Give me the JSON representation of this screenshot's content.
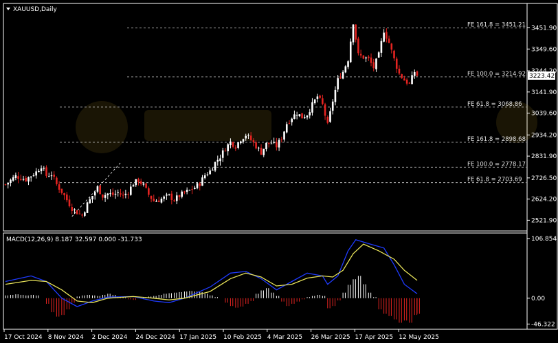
{
  "window": {
    "symbol_title": "XAUUSD,Daily",
    "macd_title": "MACD(12,26,9) 8.187 32.597 0.000 -31.733",
    "current_price": "3223.42"
  },
  "colors": {
    "background": "#000000",
    "axis": "#ffffff",
    "bull_candle": "#ffffff",
    "bear_candle": "#e52421",
    "fib_line": "#c8c8c8",
    "macd_line": "#1f3bff",
    "signal_line": "#e8e35a",
    "hist_pos": "#ffffff",
    "hist_neg": "#e52421"
  },
  "chart_data": [
    {
      "type": "candlestick",
      "title": "XAUUSD,Daily",
      "ylim": [
        2480,
        3560
      ],
      "y_ticks": [
        "3451.90",
        "3349.60",
        "3244.20",
        "3141.90",
        "3039.60",
        "2934.20",
        "2831.90",
        "2726.50",
        "2624.20",
        "2521.90"
      ],
      "x_ticks": [
        "17 Oct 2024",
        "8 Nov 2024",
        "2 Dec 2024",
        "24 Dec 2024",
        "17 Jan 2025",
        "10 Feb 2025",
        "4 Mar 2025",
        "26 Mar 2025",
        "17 Apr 2025",
        "12 May 2025"
      ],
      "fib_levels": [
        {
          "label": "FE 161.8 = 3451.21",
          "value": 3451.21
        },
        {
          "label": "FE 100.0 = 3214.92",
          "value": 3214.92
        },
        {
          "label": "FE 61.8 = 3068.86",
          "value": 3068.86
        },
        {
          "label": "FE 161.8 = 2898.68",
          "value": 2898.68
        },
        {
          "label": "FE 100.0 = 2778.17",
          "value": 2778.17
        },
        {
          "label": "FE 61.8 = 2703.69",
          "value": 2703.69
        }
      ],
      "trendline": {
        "from": [
          2536,
          2540
        ],
        "to": [
          2555,
          2800
        ]
      },
      "close_path": [
        [
          0,
          2695
        ],
        [
          4,
          2735
        ],
        [
          8,
          2720
        ],
        [
          12,
          2755
        ],
        [
          14,
          2785
        ],
        [
          16,
          2738
        ],
        [
          18,
          2745
        ],
        [
          20,
          2695
        ],
        [
          22,
          2660
        ],
        [
          24,
          2620
        ],
        [
          26,
          2580
        ],
        [
          28,
          2560
        ],
        [
          30,
          2545
        ],
        [
          32,
          2600
        ],
        [
          34,
          2640
        ],
        [
          36,
          2680
        ],
        [
          38,
          2640
        ],
        [
          40,
          2650
        ],
        [
          42,
          2645
        ],
        [
          44,
          2655
        ],
        [
          46,
          2640
        ],
        [
          48,
          2660
        ],
        [
          50,
          2700
        ],
        [
          52,
          2715
        ],
        [
          54,
          2690
        ],
        [
          56,
          2645
        ],
        [
          58,
          2615
        ],
        [
          60,
          2620
        ],
        [
          62,
          2630
        ],
        [
          64,
          2640
        ],
        [
          66,
          2620
        ],
        [
          68,
          2640
        ],
        [
          70,
          2655
        ],
        [
          72,
          2665
        ],
        [
          74,
          2680
        ],
        [
          76,
          2700
        ],
        [
          78,
          2740
        ],
        [
          80,
          2760
        ],
        [
          82,
          2800
        ],
        [
          84,
          2830
        ],
        [
          86,
          2870
        ],
        [
          88,
          2900
        ],
        [
          90,
          2880
        ],
        [
          92,
          2915
        ],
        [
          94,
          2935
        ],
        [
          96,
          2910
        ],
        [
          98,
          2880
        ],
        [
          100,
          2850
        ],
        [
          102,
          2890
        ],
        [
          104,
          2895
        ],
        [
          106,
          2880
        ],
        [
          108,
          2920
        ],
        [
          110,
          2990
        ],
        [
          112,
          3020
        ],
        [
          114,
          3040
        ],
        [
          116,
          3020
        ],
        [
          118,
          3035
        ],
        [
          120,
          3080
        ],
        [
          122,
          3120
        ],
        [
          124,
          3080
        ],
        [
          126,
          2980
        ],
        [
          128,
          3100
        ],
        [
          130,
          3200
        ],
        [
          132,
          3240
        ],
        [
          134,
          3300
        ],
        [
          136,
          3480
        ],
        [
          138,
          3320
        ],
        [
          140,
          3310
        ],
        [
          142,
          3300
        ],
        [
          144,
          3260
        ],
        [
          146,
          3320
        ],
        [
          148,
          3440
        ],
        [
          150,
          3380
        ],
        [
          152,
          3300
        ],
        [
          154,
          3230
        ],
        [
          156,
          3200
        ],
        [
          158,
          3180
        ],
        [
          160,
          3240
        ],
        [
          161,
          3223
        ]
      ]
    },
    {
      "type": "macd",
      "title": "MACD(12,26,9) 8.187 32.597 0.000 -31.733",
      "ylim": [
        -52,
        112
      ],
      "y_ticks": [
        "106.854",
        "0.00",
        "-46.322"
      ],
      "macd_line": [
        [
          0,
          30
        ],
        [
          10,
          40
        ],
        [
          16,
          30
        ],
        [
          22,
          0
        ],
        [
          28,
          -15
        ],
        [
          34,
          -5
        ],
        [
          40,
          2
        ],
        [
          50,
          3
        ],
        [
          58,
          -5
        ],
        [
          64,
          -8
        ],
        [
          70,
          0
        ],
        [
          80,
          20
        ],
        [
          88,
          45
        ],
        [
          94,
          48
        ],
        [
          100,
          35
        ],
        [
          106,
          15
        ],
        [
          112,
          30
        ],
        [
          118,
          45
        ],
        [
          124,
          40
        ],
        [
          126,
          25
        ],
        [
          130,
          40
        ],
        [
          134,
          85
        ],
        [
          137,
          105
        ],
        [
          142,
          98
        ],
        [
          148,
          90
        ],
        [
          152,
          60
        ],
        [
          156,
          25
        ],
        [
          161,
          8
        ]
      ],
      "signal_line": [
        [
          0,
          25
        ],
        [
          10,
          32
        ],
        [
          16,
          30
        ],
        [
          22,
          15
        ],
        [
          28,
          -5
        ],
        [
          34,
          -8
        ],
        [
          40,
          0
        ],
        [
          50,
          3
        ],
        [
          58,
          0
        ],
        [
          64,
          -3
        ],
        [
          70,
          0
        ],
        [
          80,
          12
        ],
        [
          88,
          35
        ],
        [
          94,
          45
        ],
        [
          100,
          38
        ],
        [
          106,
          22
        ],
        [
          112,
          25
        ],
        [
          118,
          36
        ],
        [
          124,
          40
        ],
        [
          128,
          38
        ],
        [
          132,
          50
        ],
        [
          136,
          80
        ],
        [
          140,
          97
        ],
        [
          146,
          85
        ],
        [
          152,
          70
        ],
        [
          156,
          50
        ],
        [
          161,
          32
        ]
      ],
      "histogram": [
        [
          0,
          5
        ],
        [
          2,
          6
        ],
        [
          4,
          7
        ],
        [
          6,
          6
        ],
        [
          8,
          5
        ],
        [
          10,
          6
        ],
        [
          12,
          5
        ],
        [
          14,
          0
        ],
        [
          16,
          -10
        ],
        [
          18,
          -25
        ],
        [
          20,
          -33
        ],
        [
          22,
          -30
        ],
        [
          24,
          -20
        ],
        [
          26,
          -8
        ],
        [
          28,
          3
        ],
        [
          30,
          5
        ],
        [
          32,
          6
        ],
        [
          34,
          5
        ],
        [
          36,
          4
        ],
        [
          38,
          6
        ],
        [
          40,
          8
        ],
        [
          42,
          6
        ],
        [
          44,
          3
        ],
        [
          46,
          1
        ],
        [
          48,
          -2
        ],
        [
          50,
          -3
        ],
        [
          52,
          0
        ],
        [
          54,
          2
        ],
        [
          56,
          3
        ],
        [
          58,
          4
        ],
        [
          60,
          6
        ],
        [
          62,
          8
        ],
        [
          64,
          9
        ],
        [
          66,
          10
        ],
        [
          68,
          11
        ],
        [
          70,
          12
        ],
        [
          72,
          13
        ],
        [
          74,
          12
        ],
        [
          76,
          11
        ],
        [
          78,
          8
        ],
        [
          80,
          5
        ],
        [
          82,
          2
        ],
        [
          84,
          0
        ],
        [
          86,
          -8
        ],
        [
          88,
          -14
        ],
        [
          90,
          -17
        ],
        [
          92,
          -15
        ],
        [
          94,
          -10
        ],
        [
          96,
          -5
        ],
        [
          98,
          8
        ],
        [
          100,
          14
        ],
        [
          102,
          18
        ],
        [
          104,
          10
        ],
        [
          106,
          4
        ],
        [
          108,
          -6
        ],
        [
          110,
          -14
        ],
        [
          112,
          -10
        ],
        [
          114,
          -6
        ],
        [
          116,
          -2
        ],
        [
          118,
          2
        ],
        [
          120,
          4
        ],
        [
          122,
          6
        ],
        [
          124,
          4
        ],
        [
          126,
          -18
        ],
        [
          128,
          -14
        ],
        [
          130,
          -4
        ],
        [
          132,
          10
        ],
        [
          134,
          24
        ],
        [
          136,
          34
        ],
        [
          138,
          40
        ],
        [
          140,
          25
        ],
        [
          142,
          10
        ],
        [
          144,
          2
        ],
        [
          146,
          -20
        ],
        [
          148,
          -28
        ],
        [
          150,
          -32
        ],
        [
          152,
          -38
        ],
        [
          154,
          -44
        ],
        [
          156,
          -40
        ],
        [
          158,
          -44
        ],
        [
          160,
          -30
        ],
        [
          161,
          -28
        ]
      ]
    }
  ]
}
